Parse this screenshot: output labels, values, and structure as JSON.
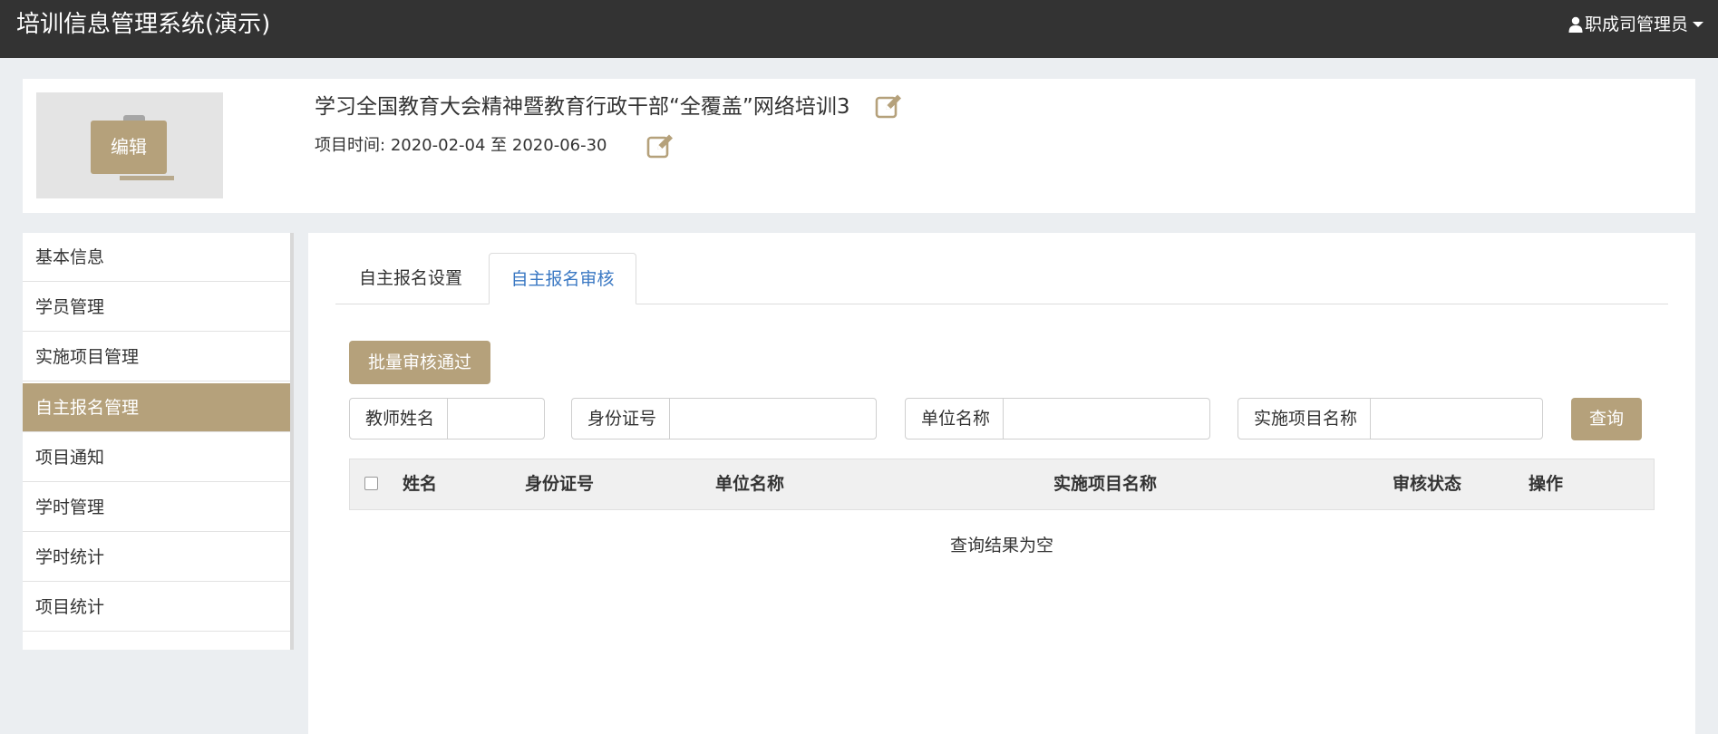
{
  "app": {
    "title": "培训信息管理系统(演示)",
    "user_label": "职成司管理员"
  },
  "header": {
    "edit_label": "编辑",
    "project_title": "学习全国教育大会精神暨教育行政干部“全覆盖”网络培训3",
    "time_label": "项目时间:",
    "time_start": "2020-02-04",
    "time_sep": "至",
    "time_end": "2020-06-30"
  },
  "sidebar": {
    "items": [
      {
        "label": "基本信息",
        "active": false
      },
      {
        "label": "学员管理",
        "active": false
      },
      {
        "label": "实施项目管理",
        "active": false
      },
      {
        "label": "自主报名管理",
        "active": true
      },
      {
        "label": "项目通知",
        "active": false
      },
      {
        "label": "学时管理",
        "active": false
      },
      {
        "label": "学时统计",
        "active": false
      },
      {
        "label": "项目统计",
        "active": false
      }
    ]
  },
  "main": {
    "tabs": [
      {
        "label": "自主报名设置",
        "active": false
      },
      {
        "label": "自主报名审核",
        "active": true
      }
    ],
    "batch_label": "批量审核通过",
    "filters": [
      {
        "label": "教师姓名",
        "value": "",
        "placeholder": ""
      },
      {
        "label": "身份证号",
        "value": "",
        "placeholder": ""
      },
      {
        "label": "单位名称",
        "value": "",
        "placeholder": ""
      },
      {
        "label": "实施项目名称",
        "value": "",
        "placeholder": ""
      }
    ],
    "query_label": "查询",
    "table": {
      "columns": [
        "姓名",
        "身份证号",
        "单位名称",
        "实施项目名称",
        "审核状态",
        "操作"
      ],
      "rows": [],
      "empty_text": "查询结果为空"
    }
  },
  "colors": {
    "accent": "#b5a17b",
    "topbar": "#333333",
    "tab_active": "#3a78c3",
    "page_bg": "#ebeef1"
  }
}
